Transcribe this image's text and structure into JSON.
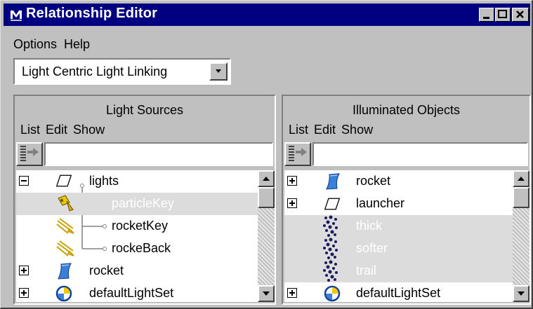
{
  "window": {
    "title": "Relationship Editor"
  },
  "menubar": {
    "options": "Options",
    "help": "Help"
  },
  "editor_mode": {
    "selected": "Light Centric Light Linking"
  },
  "left_panel": {
    "title": "Light Sources",
    "menu": {
      "list": "List",
      "edit": "Edit",
      "show": "Show"
    },
    "items": [
      {
        "label": "lights",
        "icon": "light-set-icon",
        "expander": "minus"
      },
      {
        "label": "particleKey",
        "icon": "spotlight-icon",
        "selected": true
      },
      {
        "label": "rocketKey",
        "icon": "directional-light-icon"
      },
      {
        "label": "rockeBack",
        "icon": "directional-light-icon"
      },
      {
        "label": "rocket",
        "icon": "nurbs-surface-icon",
        "expander": "plus"
      },
      {
        "label": "defaultLightSet",
        "icon": "default-set-icon",
        "expander": "plus"
      }
    ]
  },
  "right_panel": {
    "title": "Illuminated Objects",
    "menu": {
      "list": "List",
      "edit": "Edit",
      "show": "Show"
    },
    "items": [
      {
        "label": "rocket",
        "icon": "nurbs-surface-icon",
        "expander": "plus"
      },
      {
        "label": "launcher",
        "icon": "set-icon",
        "expander": "plus"
      },
      {
        "label": "thick",
        "icon": "particle-icon",
        "selected": true
      },
      {
        "label": "softer",
        "icon": "particle-icon",
        "selected": true
      },
      {
        "label": "trail",
        "icon": "particle-icon",
        "selected": true
      },
      {
        "label": "defaultLightSet",
        "icon": "default-set-icon",
        "expander": "plus"
      }
    ]
  }
}
